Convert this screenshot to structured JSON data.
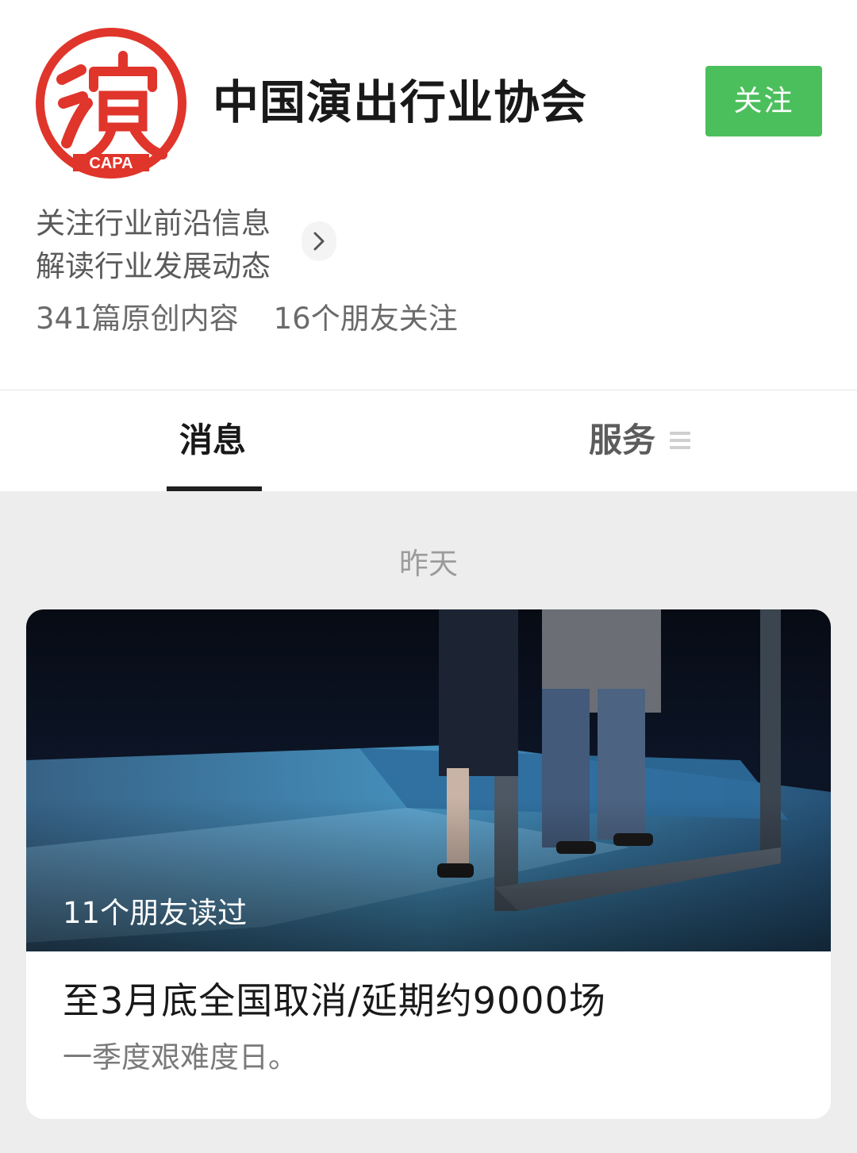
{
  "account": {
    "name": "中国演出行业协会",
    "logo_text": "演",
    "logo_subtext": "CAPA",
    "follow_label": "关注",
    "intro": [
      "关注行业前沿信息",
      "解读行业发展动态"
    ],
    "stats": [
      "341篇原创内容",
      "16个朋友关注"
    ],
    "brand_color": "#4cbf5d",
    "logo_color": "#e0352b"
  },
  "tabs": {
    "messages_label": "消息",
    "services_label": "服务"
  },
  "feed": {
    "date_label": "昨天",
    "article": {
      "read_count": "11个朋友读过",
      "title": "至3月底全国取消/延期约9000场",
      "digest": "一季度艰难度日。"
    }
  },
  "icons": {
    "chevron": "chevron-right-icon",
    "menu": "menu-icon"
  }
}
